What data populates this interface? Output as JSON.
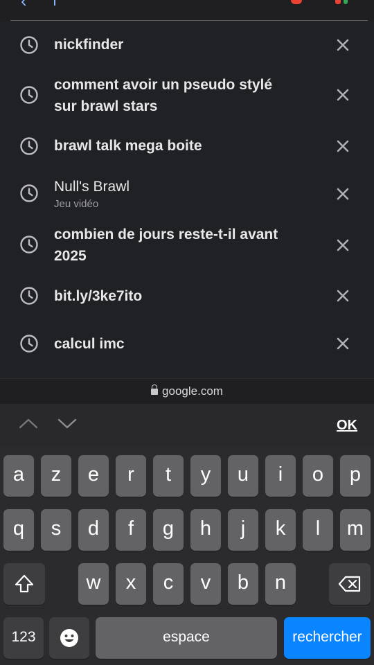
{
  "header": {
    "back_icon": "back-arrow-icon",
    "mic_color": "#ea4335"
  },
  "history": [
    {
      "lines": [
        "nickfinder"
      ],
      "bold": true
    },
    {
      "lines": [
        "comment avoir un pseudo stylé",
        "sur brawl stars"
      ],
      "bold": true
    },
    {
      "lines": [
        "brawl talk mega boite"
      ],
      "bold": true
    },
    {
      "lines": [
        "Null's Brawl"
      ],
      "bold": false,
      "subtitle": "Jeu vidéo"
    },
    {
      "lines": [
        "combien de jours reste-t-il avant",
        "2025"
      ],
      "bold": true
    },
    {
      "lines": [
        "bit.ly/3ke7ito"
      ],
      "bold": true
    },
    {
      "lines": [
        "calcul imc"
      ],
      "bold": true
    }
  ],
  "url_bar": {
    "domain": "google.com"
  },
  "accessory": {
    "ok_label": "OK"
  },
  "keyboard": {
    "row1": [
      "a",
      "z",
      "e",
      "r",
      "t",
      "y",
      "u",
      "i",
      "o",
      "p"
    ],
    "row2": [
      "q",
      "s",
      "d",
      "f",
      "g",
      "h",
      "j",
      "k",
      "l",
      "m"
    ],
    "row3": [
      "w",
      "x",
      "c",
      "v",
      "b",
      "n"
    ],
    "numbers_label": "123",
    "space_label": "espace",
    "search_label": "rechercher",
    "accent_color": "#0a84ff"
  }
}
